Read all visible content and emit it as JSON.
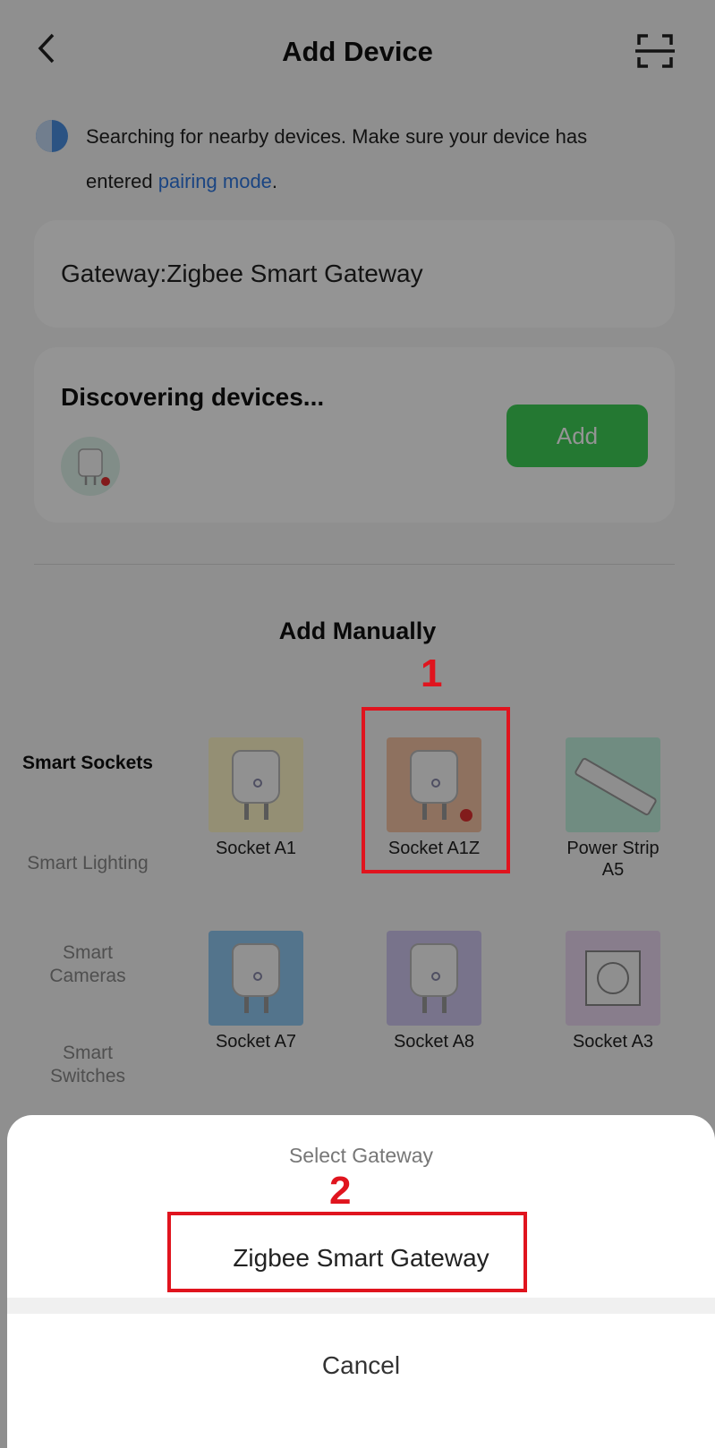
{
  "header": {
    "title": "Add Device"
  },
  "hint": {
    "text": "Searching for nearby devices. Make sure your device has entered ",
    "link": "pairing mode",
    "suffix": "."
  },
  "gateway_card": {
    "text": "Gateway:Zigbee Smart Gateway"
  },
  "discover_card": {
    "title": "Discovering devices...",
    "add_label": "Add"
  },
  "manual": {
    "title": "Add Manually",
    "categories": [
      {
        "label": "Smart Sockets",
        "active": true
      },
      {
        "label": "Smart Lighting",
        "active": false
      },
      {
        "label": "Smart Cameras",
        "active": false
      },
      {
        "label": "Smart Switches",
        "active": false
      }
    ],
    "products": [
      {
        "label": "Socket A1",
        "bg": "#fff6c8"
      },
      {
        "label": "Socket A1Z",
        "bg": "#f4c3a4"
      },
      {
        "label": "Power Strip A5",
        "bg": "#c2f1de"
      },
      {
        "label": "Socket A7",
        "bg": "#8fc9f1"
      },
      {
        "label": "Socket A8",
        "bg": "#cfc7ef"
      },
      {
        "label": "Socket A3",
        "bg": "#ead8f2"
      }
    ]
  },
  "sheet": {
    "title": "Select Gateway",
    "option": "Zigbee Smart Gateway",
    "cancel": "Cancel"
  },
  "annotations": {
    "step1": "1",
    "step2": "2",
    "color": "#e0141e"
  }
}
